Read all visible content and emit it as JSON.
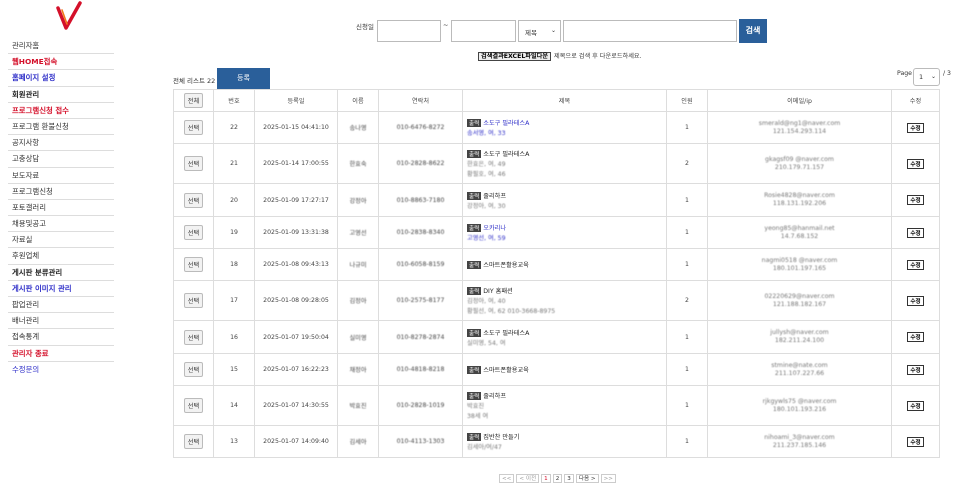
{
  "sidebar": {
    "menu": [
      {
        "label": "관리자홈",
        "style": "normal"
      },
      {
        "label": "웹HOME접속",
        "style": "red"
      },
      {
        "label": "홈페이지 설정",
        "style": "blue"
      },
      {
        "label": "회원관리",
        "style": "bold"
      },
      {
        "label": "프로그램신청 접수",
        "style": "red"
      },
      {
        "label": "프로그램 환불신청",
        "style": "normal"
      },
      {
        "label": "공지사항",
        "style": "normal"
      },
      {
        "label": "고충상담",
        "style": "normal"
      },
      {
        "label": "보도자료",
        "style": "normal"
      },
      {
        "label": "프로그램신청",
        "style": "normal"
      },
      {
        "label": "포토갤러리",
        "style": "normal"
      },
      {
        "label": "채용및공고",
        "style": "normal"
      },
      {
        "label": "자료실",
        "style": "normal"
      },
      {
        "label": "후원업체",
        "style": "normal"
      },
      {
        "label": "게시판 분류관리",
        "style": "bold"
      },
      {
        "label": "게시판 이미지 관리",
        "style": "blue"
      },
      {
        "label": "팝업관리",
        "style": "normal"
      },
      {
        "label": "배너관리",
        "style": "normal"
      },
      {
        "label": "접속통계",
        "style": "normal"
      },
      {
        "label": "관리자 종료",
        "style": "red"
      },
      {
        "label": "수정문의",
        "style": "bluen"
      }
    ]
  },
  "search": {
    "date_label": "신청일",
    "date_sep": "~",
    "field_selected": "제목",
    "button": "검색",
    "excel_button": "검색결과EXCEL파일다운",
    "excel_hint": "제목으로 검색 후 다운로드하세요."
  },
  "toolbar": {
    "total_label": "전체 리스트",
    "total_count": "22",
    "register": "등록",
    "page_label": "Page",
    "page_selected": "1",
    "page_total": "/ 3"
  },
  "table": {
    "headers": [
      "전체",
      "번호",
      "등록일",
      "이름",
      "연락처",
      "제목",
      "인원",
      "이메일/ip",
      "수정"
    ],
    "select_label": "선택",
    "edit_label": "수정",
    "tag_label": "출력",
    "rows": [
      {
        "no": "22",
        "date": "2025-01-15 04:41:10",
        "name": "송나영",
        "phone": "010-6476-8272",
        "title": "소도구 필라테스A",
        "title_blue": true,
        "sub": [
          "송서영, 여, 33"
        ],
        "sub_blue": true,
        "count": "1",
        "count_blue": false,
        "email": "smerald@ng1@naver.com",
        "ip": "121.154.293.114"
      },
      {
        "no": "21",
        "date": "2025-01-14 17:00:55",
        "name": "한효숙",
        "phone": "010-2828-8622",
        "title": "소도구 필라테스A",
        "title_blue": false,
        "sub": [
          "한효은, 여, 49",
          "황필호, 여, 46"
        ],
        "sub_blue": false,
        "count": "2",
        "count_blue": false,
        "email": "gkagsf09 @naver.com",
        "ip": "210.179.71.157"
      },
      {
        "no": "20",
        "date": "2025-01-09 17:27:17",
        "name": "강정아",
        "phone": "010-8863-7180",
        "title": "줄리하프",
        "title_blue": false,
        "sub": [
          "강정아, 여, 30"
        ],
        "sub_blue": false,
        "count": "1",
        "count_blue": false,
        "email": "Rosie4828@naver.com",
        "ip": "118.131.192.206"
      },
      {
        "no": "19",
        "date": "2025-01-09 13:31:38",
        "name": "고영선",
        "phone": "010-2838-8340",
        "title": "오카리나",
        "title_blue": true,
        "sub": [
          "고영선, 여, 59"
        ],
        "sub_blue": true,
        "count": "1",
        "count_blue": false,
        "email": "yeong85@hanmail.net",
        "ip": "14.7.68.152"
      },
      {
        "no": "18",
        "date": "2025-01-08 09:43:13",
        "name": "나규미",
        "phone": "010-6058-8159",
        "title": "스마트폰활용교육",
        "title_blue": false,
        "sub": [],
        "sub_blue": false,
        "count": "1",
        "count_blue": false,
        "email": "nagmi0518 @naver.com",
        "ip": "180.101.197.165"
      },
      {
        "no": "17",
        "date": "2025-01-08 09:28:05",
        "name": "김정아",
        "phone": "010-2575-8177",
        "title": "DIY 홈패션",
        "title_blue": false,
        "sub": [
          "김정아, 여, 40",
          "황필선, 여, 62 010-3668-8975"
        ],
        "sub_blue": false,
        "count": "2",
        "count_blue": false,
        "email": "02220629@naver.com",
        "ip": "121.188.182.167"
      },
      {
        "no": "16",
        "date": "2025-01-07 19:50:04",
        "name": "실미영",
        "phone": "010-8278-2874",
        "title": "소도구 필라테스A",
        "title_blue": false,
        "sub": [
          "실미영, 54, 여"
        ],
        "sub_blue": false,
        "count": "1",
        "count_blue": true,
        "email": "jullysh@naver.com",
        "ip": "182.211.24.100"
      },
      {
        "no": "15",
        "date": "2025-01-07 16:22:23",
        "name": "채정아",
        "phone": "010-4818-8218",
        "title": "스마트폰활용교육",
        "title_blue": false,
        "sub": [],
        "sub_blue": false,
        "count": "1",
        "count_blue": false,
        "email": "stmine@nate.com",
        "ip": "211.107.227.66"
      },
      {
        "no": "14",
        "date": "2025-01-07 14:30:55",
        "name": "박효진",
        "phone": "010-2828-1019",
        "title": "줄리하프",
        "title_blue": false,
        "sub": [
          "박효진",
          "38세 여"
        ],
        "sub_blue": false,
        "count": "1",
        "count_blue": false,
        "email": "rjkgywls75 @naver.com",
        "ip": "180.101.193.216"
      },
      {
        "no": "13",
        "date": "2025-01-07 14:09:40",
        "name": "김세아",
        "phone": "010-4113-1303",
        "title": "집반찬 만들기",
        "title_blue": false,
        "sub": [
          "김세아/여/47"
        ],
        "sub_blue": false,
        "count": "1",
        "count_blue": false,
        "email": "nihoami_3@naver.com",
        "ip": "211.237.185.146"
      }
    ]
  },
  "pager": {
    "first": "<<",
    "prev": "< 이전",
    "pages": [
      "1",
      "2",
      "3"
    ],
    "current": "1",
    "next": "다음 >",
    "last": ">>"
  },
  "colors": {
    "accent": "#2a5f9a",
    "red": "#d4102a",
    "blue": "#2e2ec8"
  }
}
